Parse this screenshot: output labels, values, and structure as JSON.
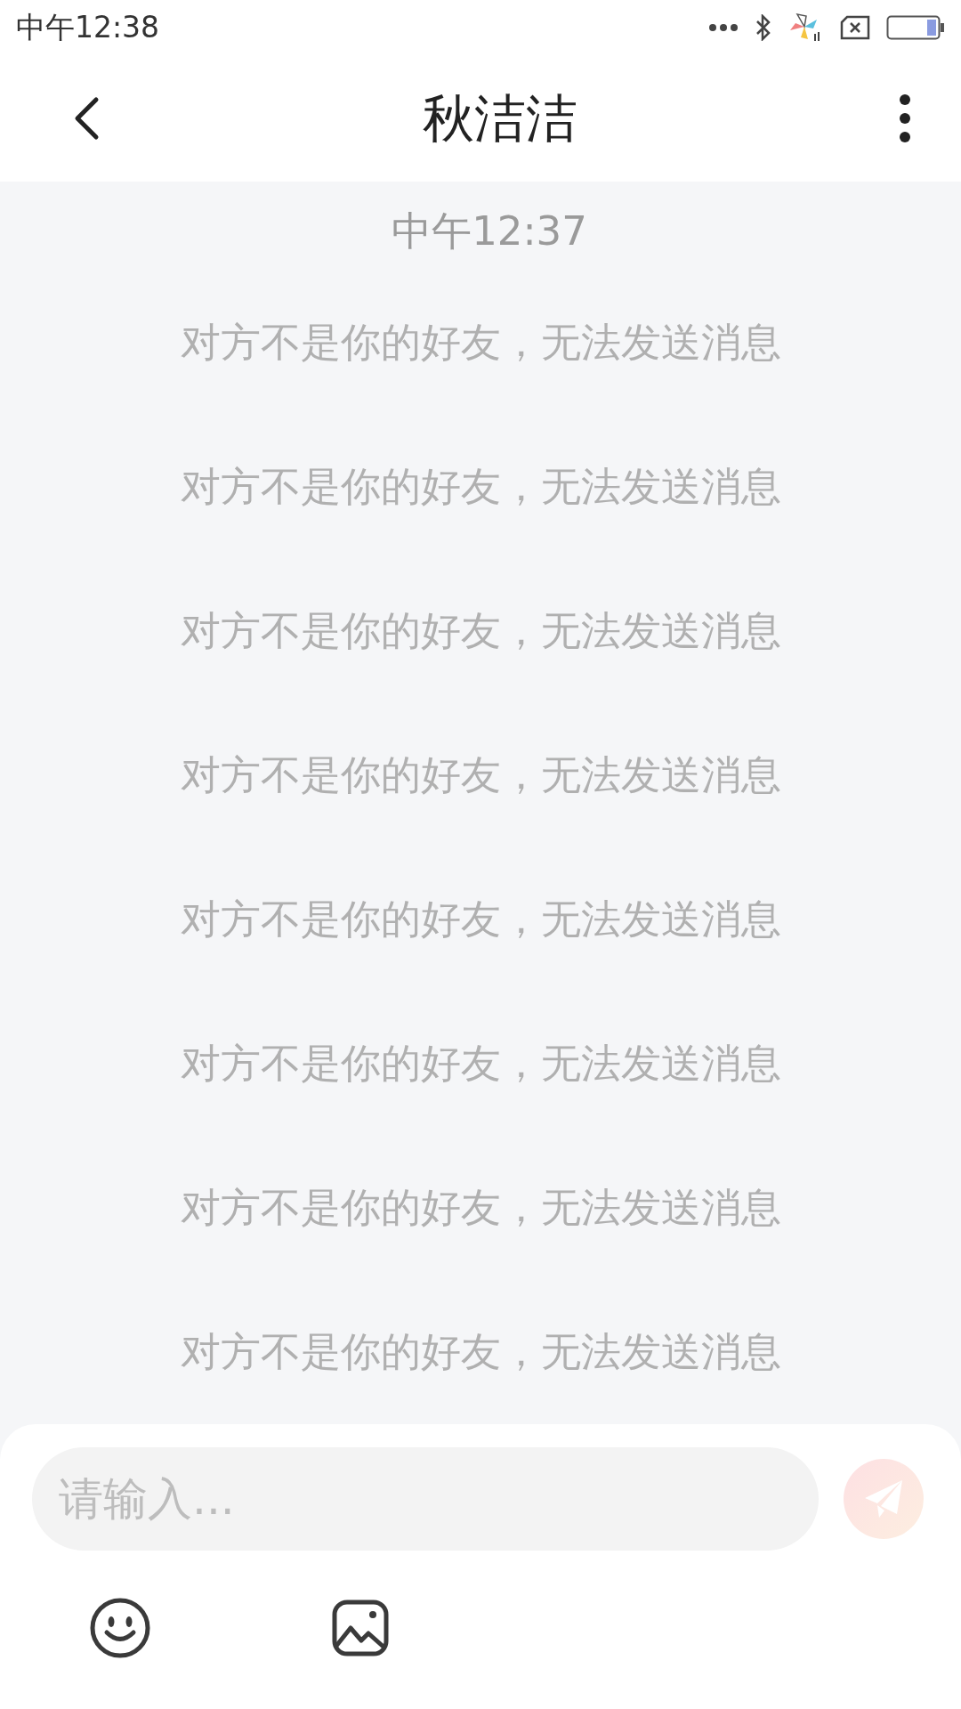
{
  "status_bar": {
    "time": "中午12:38"
  },
  "header": {
    "title": "秋洁洁"
  },
  "chat": {
    "timestamp": "中午12:37",
    "messages": [
      {
        "kind": "system",
        "text": "对方不是你的好友，无法发送消息"
      },
      {
        "kind": "system",
        "text": "对方不是你的好友，无法发送消息"
      },
      {
        "kind": "system",
        "text": "对方不是你的好友，无法发送消息"
      },
      {
        "kind": "system",
        "text": "对方不是你的好友，无法发送消息"
      },
      {
        "kind": "system",
        "text": "对方不是你的好友，无法发送消息"
      },
      {
        "kind": "system",
        "text": "对方不是你的好友，无法发送消息"
      },
      {
        "kind": "system",
        "text": "对方不是你的好友，无法发送消息"
      },
      {
        "kind": "system",
        "text": "对方不是你的好友，无法发送消息"
      }
    ]
  },
  "composer": {
    "placeholder": "请输入...",
    "send_disabled": true
  }
}
